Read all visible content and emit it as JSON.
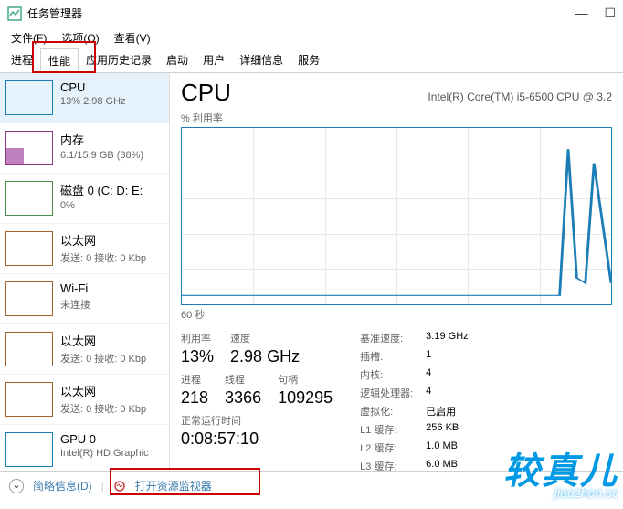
{
  "window": {
    "title": "任务管理器",
    "menu": {
      "file": "文件(F)",
      "options": "选项(O)",
      "view": "查看(V)"
    },
    "controls": {
      "min": "—",
      "max": "☐"
    }
  },
  "tabs": {
    "processes": "进程",
    "performance": "性能",
    "app_history": "应用历史记录",
    "startup": "启动",
    "users": "用户",
    "details": "详细信息",
    "services": "服务"
  },
  "sidebar": {
    "items": [
      {
        "name": "CPU",
        "sub": "13% 2.98 GHz"
      },
      {
        "name": "内存",
        "sub": "6.1/15.9 GB (38%)"
      },
      {
        "name": "磁盘 0 (C: D: E:",
        "sub": "0%"
      },
      {
        "name": "以太网",
        "sub": "发送: 0 接收: 0 Kbp"
      },
      {
        "name": "Wi-Fi",
        "sub": "未连接"
      },
      {
        "name": "以太网",
        "sub": "发送: 0 接收: 0 Kbp"
      },
      {
        "name": "以太网",
        "sub": "发送: 0 接收: 0 Kbp"
      },
      {
        "name": "GPU 0",
        "sub": "Intel(R) HD Graphic"
      }
    ]
  },
  "content": {
    "title": "CPU",
    "model": "Intel(R) Core(TM) i5-6500 CPU @ 3.2",
    "graph_label": "% 利用率",
    "xaxis": "60 秒",
    "stats": {
      "util_label": "利用率",
      "util": "13%",
      "speed_label": "速度",
      "speed": "2.98 GHz",
      "proc_label": "进程",
      "proc": "218",
      "thread_label": "线程",
      "thread": "3366",
      "handle_label": "句柄",
      "handle": "109295",
      "uptime_label": "正常运行时间",
      "uptime": "0:08:57:10"
    },
    "right": {
      "base_k": "基准速度:",
      "base_v": "3.19 GHz",
      "sock_k": "插槽:",
      "sock_v": "1",
      "core_k": "内核:",
      "core_v": "4",
      "logic_k": "逻辑处理器:",
      "logic_v": "4",
      "virt_k": "虚拟化:",
      "virt_v": "已启用",
      "l1_k": "L1 缓存:",
      "l1_v": "256 KB",
      "l2_k": "L2 缓存:",
      "l2_v": "1.0 MB",
      "l3_k": "L3 缓存:",
      "l3_v": "6.0 MB"
    }
  },
  "footer": {
    "fewer": "简略信息(D)",
    "resmon": "打开资源监视器"
  },
  "watermark": {
    "cn": "较真儿",
    "en": "jiaozhen.cc"
  },
  "chart_data": {
    "type": "line",
    "title": "% 利用率",
    "xlabel": "60 秒",
    "ylabel": "%",
    "ylim": [
      0,
      100
    ],
    "x_seconds": [
      60,
      55,
      50,
      45,
      40,
      35,
      30,
      25,
      20,
      15,
      10,
      5,
      4,
      3,
      2,
      1,
      0
    ],
    "values": [
      5,
      5,
      5,
      5,
      5,
      5,
      5,
      5,
      5,
      5,
      5,
      5,
      90,
      15,
      12,
      80,
      12
    ]
  }
}
